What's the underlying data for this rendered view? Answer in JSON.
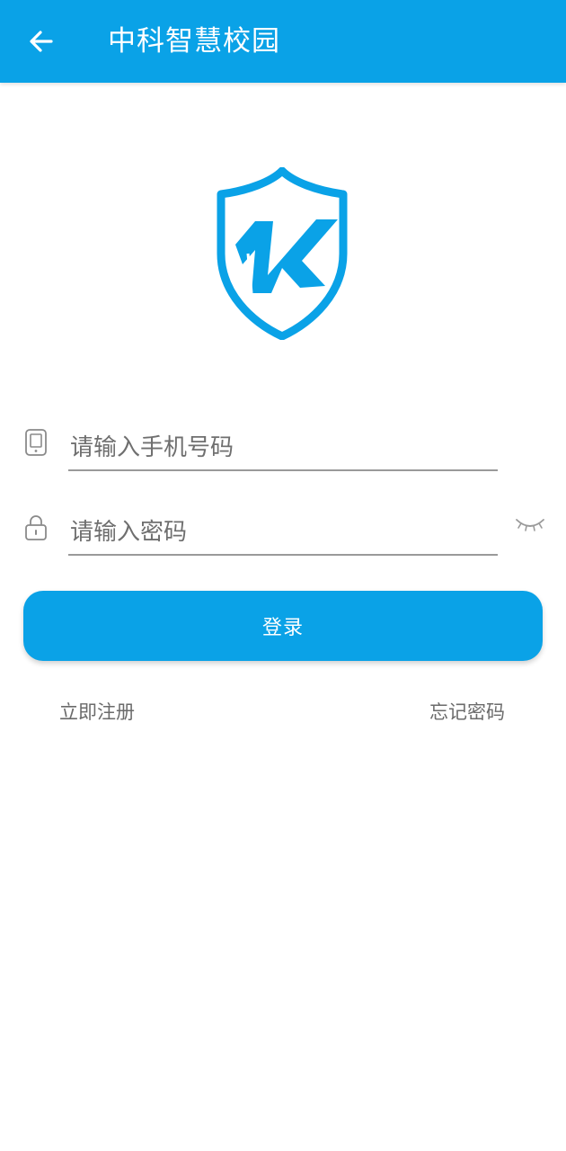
{
  "header": {
    "title": "中科智慧校园",
    "background_color": "#0aa2e7"
  },
  "logo": {
    "icon": "shield-k-logo",
    "color": "#0aa2e7"
  },
  "form": {
    "phone": {
      "placeholder": "请输入手机号码",
      "value": "",
      "icon": "phone-icon"
    },
    "password": {
      "placeholder": "请输入密码",
      "value": "",
      "icon": "lock-icon",
      "toggle_icon": "eye-closed-icon"
    },
    "login_label": "登录"
  },
  "links": {
    "register": "立即注册",
    "forgot": "忘记密码"
  }
}
